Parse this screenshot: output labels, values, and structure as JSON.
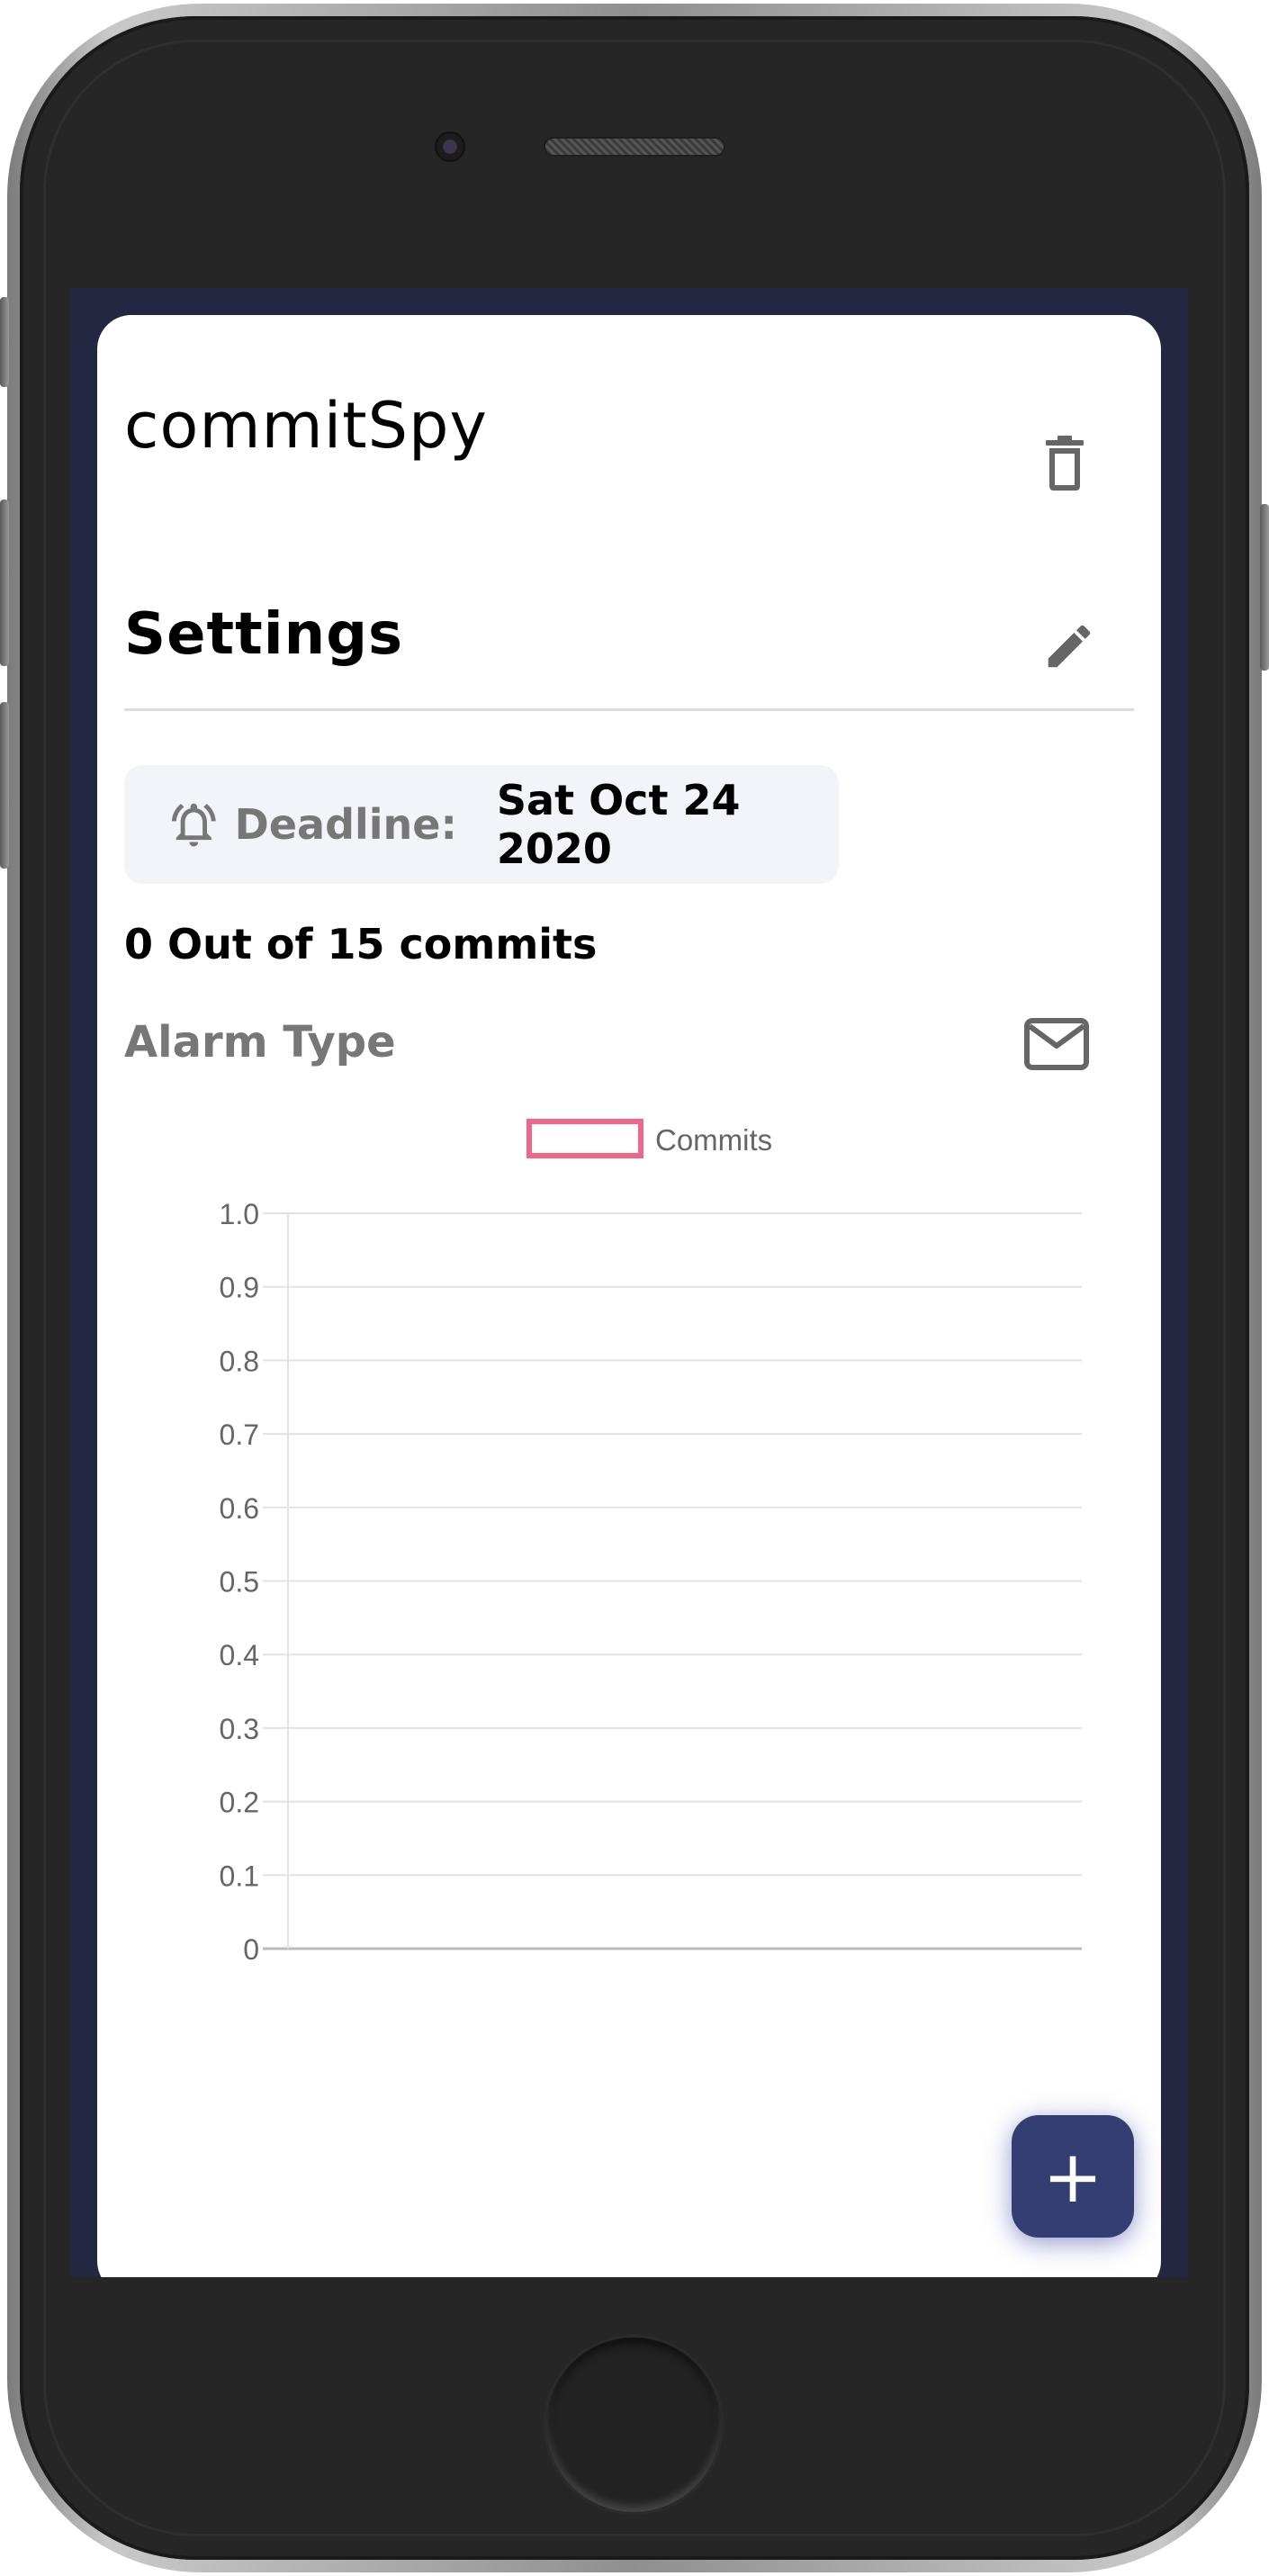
{
  "app": {
    "title": "commitSpy",
    "section_title": "Settings"
  },
  "deadline": {
    "label": "Deadline:",
    "value": "Sat Oct 24 2020"
  },
  "progress": {
    "text": "0 Out of 15 commits",
    "done": 0,
    "total": 15
  },
  "alarm": {
    "label": "Alarm Type",
    "icon": "mail-icon"
  },
  "icons": {
    "delete": "trash-icon",
    "edit": "pencil-icon",
    "deadline": "bell-icon",
    "add": "plus-icon"
  },
  "fab": {
    "label": "+"
  },
  "colors": {
    "screen_background": "#232741",
    "fab": "#333e73",
    "series_border": "#f0668a",
    "muted_text": "#777777"
  },
  "chart_data": {
    "type": "line",
    "title": "",
    "xlabel": "",
    "ylabel": "",
    "legend_position": "top",
    "grid": true,
    "ylim": [
      0,
      1
    ],
    "y_ticks": [
      "0",
      "0.1",
      "0.2",
      "0.3",
      "0.4",
      "0.5",
      "0.6",
      "0.7",
      "0.8",
      "0.9",
      "1.0"
    ],
    "categories": [],
    "series": [
      {
        "name": "Commits",
        "values": [],
        "color": "#f0668a"
      }
    ]
  }
}
